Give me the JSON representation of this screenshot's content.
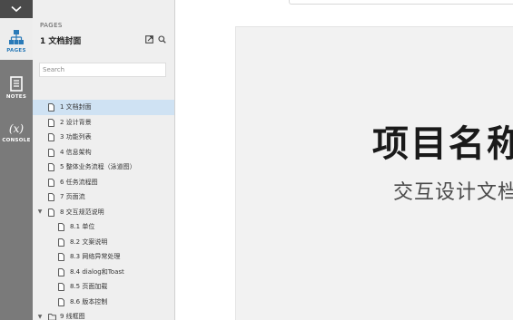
{
  "rail": {
    "pages_label": "PAGES",
    "notes_label": "NOTES",
    "console_label": "CONSOLE",
    "console_glyph": "(x)",
    "active_color": "#2a7ab8",
    "rail_color": "#7a7a7a"
  },
  "panel": {
    "header": "PAGES",
    "current_page": "1 文档封面",
    "search_placeholder": "Search"
  },
  "tree": [
    {
      "label": "1 文档封面",
      "type": "page",
      "level": 0,
      "selected": true
    },
    {
      "label": "2 设计背景",
      "type": "page",
      "level": 0
    },
    {
      "label": "3 功能列表",
      "type": "page",
      "level": 0
    },
    {
      "label": "4 信息架构",
      "type": "page",
      "level": 0
    },
    {
      "label": "5 整体业务流程（泳道图）",
      "type": "page",
      "level": 0
    },
    {
      "label": "6 任务流程图",
      "type": "page",
      "level": 0
    },
    {
      "label": "7 页面流",
      "type": "page",
      "level": 0
    },
    {
      "label": "8 交互规范说明",
      "type": "page",
      "level": 0,
      "expanded": true
    },
    {
      "label": "8.1 单位",
      "type": "page",
      "level": 1
    },
    {
      "label": "8.2 文案说明",
      "type": "page",
      "level": 1
    },
    {
      "label": "8.3 网络异常处理",
      "type": "page",
      "level": 1
    },
    {
      "label": "8.4 dialog和Toast",
      "type": "page",
      "level": 1
    },
    {
      "label": "8.5 页面加载",
      "type": "page",
      "level": 1
    },
    {
      "label": "8.6 版本控制",
      "type": "page",
      "level": 1
    },
    {
      "label": "9 线框图",
      "type": "folder",
      "level": 0,
      "expanded": true
    }
  ],
  "canvas": {
    "title": "项目名称",
    "subtitle": "交互设计文档"
  }
}
